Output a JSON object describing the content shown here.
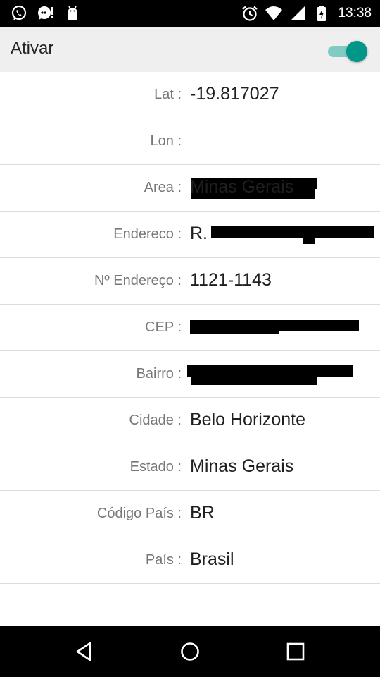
{
  "status_bar": {
    "time": "13:38",
    "left_icons": [
      "whatsapp-icon",
      "chat-notification-icon",
      "android-debug-icon"
    ],
    "right_icons": [
      "alarm-icon",
      "wifi-icon",
      "signal-icon",
      "battery-icon"
    ]
  },
  "header": {
    "title": "Ativar",
    "toggle_on": true,
    "accent_color": "#009688"
  },
  "rows": [
    {
      "label": "Lat :",
      "value": "-19.817027"
    },
    {
      "label": "Lon :",
      "value": ""
    },
    {
      "label": "Area :",
      "value": "Minas Gerais"
    },
    {
      "label": "Endereco :",
      "value": "R. "
    },
    {
      "label": "Nº Endereço :",
      "value": "1121-1143"
    },
    {
      "label": "CEP :",
      "value": ""
    },
    {
      "label": "Bairro :",
      "value": ""
    },
    {
      "label": "Cidade :",
      "value": "Belo Horizonte"
    },
    {
      "label": "Estado :",
      "value": "Minas Gerais"
    },
    {
      "label": "Código País :",
      "value": "BR"
    },
    {
      "label": "País :",
      "value": "Brasil"
    }
  ],
  "nav_bar": {
    "icons": [
      "back-icon",
      "home-icon",
      "recents-icon"
    ]
  }
}
